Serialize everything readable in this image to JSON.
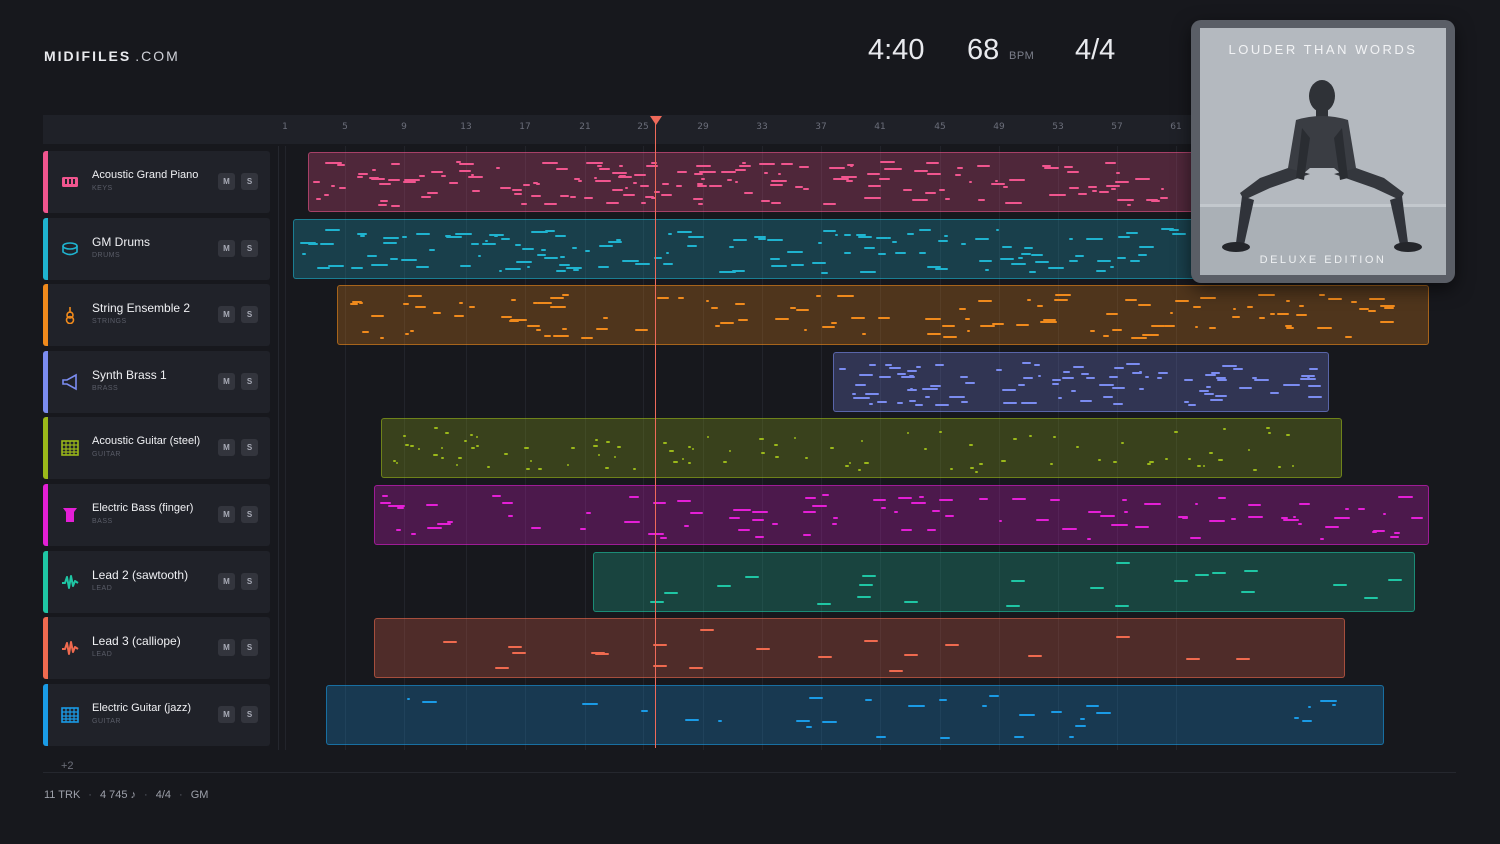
{
  "brand": {
    "name": "MIDIFILES",
    "suffix": ".COM"
  },
  "header": {
    "time": "4:40",
    "bpm": "68",
    "bpm_unit": "BPM",
    "time_signature": "4/4"
  },
  "ruler": {
    "ticks": [
      "1",
      "5",
      "9",
      "13",
      "17",
      "21",
      "25",
      "29",
      "33",
      "37",
      "41",
      "45",
      "49",
      "53",
      "57",
      "61"
    ]
  },
  "tracks": [
    {
      "name": "Acoustic Grand Piano",
      "category": "KEYS",
      "color": "#f0558e",
      "icon": "piano-icon",
      "mute": "M",
      "solo": "S"
    },
    {
      "name": "GM Drums",
      "category": "DRUMS",
      "color": "#1fb3cf",
      "icon": "drum-icon",
      "mute": "M",
      "solo": "S"
    },
    {
      "name": "String Ensemble 2",
      "category": "STRINGS",
      "color": "#f08a1c",
      "icon": "violin-icon",
      "mute": "M",
      "solo": "S"
    },
    {
      "name": "Synth Brass 1",
      "category": "BRASS",
      "color": "#7b8cf0",
      "icon": "horn-icon",
      "mute": "M",
      "solo": "S"
    },
    {
      "name": "Acoustic Guitar (steel)",
      "category": "GUITAR",
      "color": "#9bb81a",
      "icon": "guitar-fretboard-icon",
      "mute": "M",
      "solo": "S"
    },
    {
      "name": "Electric Bass (finger)",
      "category": "BASS",
      "color": "#e41fd6",
      "icon": "bass-icon",
      "mute": "M",
      "solo": "S"
    },
    {
      "name": "Lead 2 (sawtooth)",
      "category": "LEAD",
      "color": "#1fc6a4",
      "icon": "waveform-icon",
      "mute": "M",
      "solo": "S"
    },
    {
      "name": "Lead 3 (calliope)",
      "category": "LEAD",
      "color": "#ef6a4f",
      "icon": "waveform-icon",
      "mute": "M",
      "solo": "S"
    },
    {
      "name": "Electric Guitar (jazz)",
      "category": "GUITAR",
      "color": "#1a9be6",
      "icon": "guitar-fretboard-icon",
      "mute": "M",
      "solo": "S"
    }
  ],
  "more_tracks": "+2",
  "album": {
    "title": "LOUDER THAN WORDS",
    "edition": "DELUXE EDITION"
  },
  "footer": {
    "tracks": "11 TRK",
    "notes": "4 745 ♪",
    "time_signature": "4/4",
    "standard": "GM"
  }
}
